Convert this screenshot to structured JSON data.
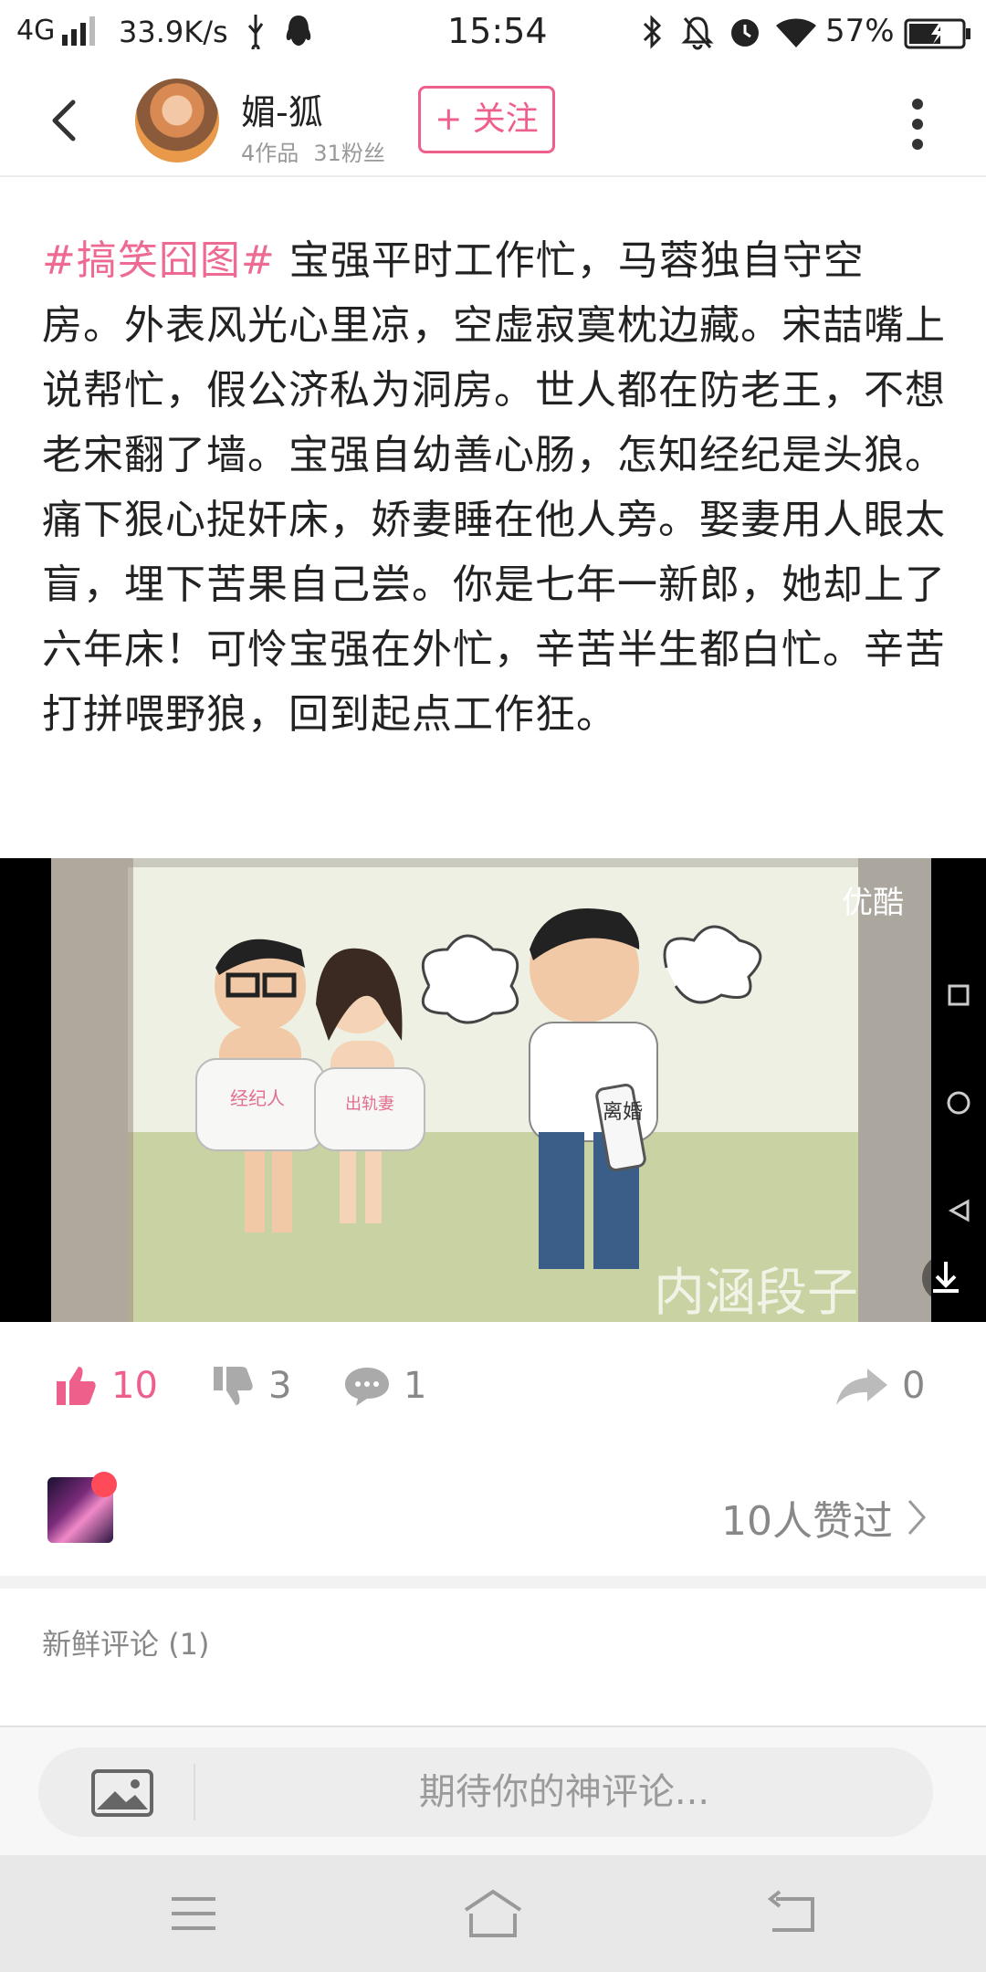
{
  "status_bar": {
    "network": "4G",
    "speed": "33.9K/s",
    "time": "15:54",
    "battery_percent": "57%"
  },
  "header": {
    "author_name": "媚-狐",
    "works": "4作品",
    "fans": "31粉丝",
    "follow_label": "+ 关注"
  },
  "post": {
    "hashtag": "#搞笑囧图#",
    "text": " 宝强平时工作忙，马蓉独自守空房。外表风光心里凉，空虚寂寞枕边藏。宋喆嘴上说帮忙，假公济私为洞房。世人都在防老王，不想老宋翻了墙。宝强自幼善心肠，怎知经纪是头狼。痛下狠心捉奸床，娇妻睡在他人旁。娶妻用人眼太盲，埋下苦果自己尝。你是七年一新郎，她却上了六年床！可怜宝强在外忙，辛苦半生都白忙。辛苦打拼喂野狼，回到起点工作狂。",
    "image": {
      "watermark": "优酷",
      "pillow_label_left": "经纪人",
      "pillow_label_right": "出轨妻",
      "paper_label": "离婚",
      "caption": "内涵段子"
    }
  },
  "actions": {
    "likes": "10",
    "dislikes": "3",
    "comments": "1",
    "shares": "0"
  },
  "likers": {
    "count_label": "10人赞过"
  },
  "comments": {
    "title": "新鲜评论",
    "count": "(1)"
  },
  "comment_bar": {
    "placeholder": "期待你的神评论..."
  },
  "colors": {
    "accent": "#ee5f8b",
    "hashtag": "#ee6a93",
    "muted": "#888888"
  }
}
